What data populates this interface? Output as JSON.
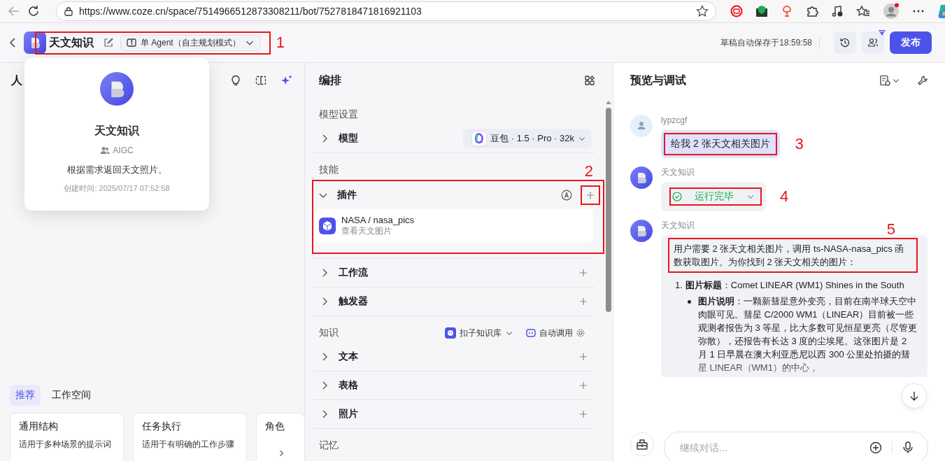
{
  "browser": {
    "url": "https://www.coze.cn/space/7514966512873308211/bot/7527818471816921103"
  },
  "header": {
    "title": "天文知识",
    "mode": "单 Agent（自主规划模式）",
    "annotation": "1",
    "save_status": "草稿自动保存于18:59:58",
    "publish": "发布"
  },
  "popover": {
    "name": "天文知识",
    "team": "AIGC",
    "description": "根据需求返回天文照片。",
    "created": "创建时间: 2025/07/17 07:52:58"
  },
  "prompt_panel": {
    "title": "人",
    "tabs": [
      {
        "label": "推荐",
        "selected": true
      },
      {
        "label": "工作空间",
        "selected": false
      }
    ],
    "cards": [
      {
        "title": "通用结构",
        "description": "适用于多种场景的提示词"
      },
      {
        "title": "任务执行",
        "description": "适用于有明确的工作步骤"
      },
      {
        "title": "角色"
      }
    ]
  },
  "arrange": {
    "title": "编排",
    "sections": [
      {
        "heading": "模型设置",
        "rows": [
          {
            "kind": "model",
            "label": "模型",
            "expanded": false,
            "value": "豆包 · 1.5 · Pro · 32k"
          }
        ]
      },
      {
        "heading": "技能",
        "rows": [
          {
            "kind": "plugin",
            "label": "插件",
            "expanded": true,
            "annotation": "2",
            "items": [
              {
                "name": "NASA / nasa_pics",
                "description": "查看天文图片"
              }
            ]
          },
          {
            "kind": "item",
            "label": "工作流",
            "expanded": false
          },
          {
            "kind": "item",
            "label": "触发器",
            "expanded": false
          }
        ]
      },
      {
        "heading": "知识",
        "source": "扣子知识库",
        "call_mode": "自动调用",
        "rows": [
          {
            "kind": "item",
            "label": "文本",
            "expanded": false
          },
          {
            "kind": "item",
            "label": "表格",
            "expanded": false
          },
          {
            "kind": "item",
            "label": "照片",
            "expanded": false
          }
        ]
      },
      {
        "heading": "记忆"
      }
    ]
  },
  "preview": {
    "title": "预览与调试",
    "messages": [
      {
        "kind": "user",
        "sender": "lypzcgf",
        "text": "给我 2 张天文相关图片",
        "annotation": "3"
      },
      {
        "kind": "status",
        "sender": "天文知识",
        "status": "运行完毕",
        "expanded": false,
        "annotation": "4"
      },
      {
        "kind": "answer",
        "sender": "天文知识",
        "text": "用户需要 2 张天文相关图片，调用 ts-NASA-nasa_pics 函数获取图片。为你找到 2 张天文相关的图片：",
        "annotation": "5",
        "list": [
          {
            "number": "1.",
            "text": "**图片标题**：Comet LINEAR (WM1) Shines in the South",
            "bullets": [
              "**图片说明**：一颗新彗星意外变亮，目前在南半球天空中肉眼可见。彗星 C/2000 WM1（LINEAR）目前被一些观测者报告为 3 等星，比大多数可见恒星更亮（尽管更弥散），还报告有长达 3 度的尘埃尾。这张图片是 2 月 1 日早晨在澳大利亚悉尼以西 300 公里处拍摄的彗星 LINEAR（WM1）的中心，"
            ]
          }
        ]
      }
    ],
    "input": {
      "placeholder": "继续对话..."
    }
  }
}
